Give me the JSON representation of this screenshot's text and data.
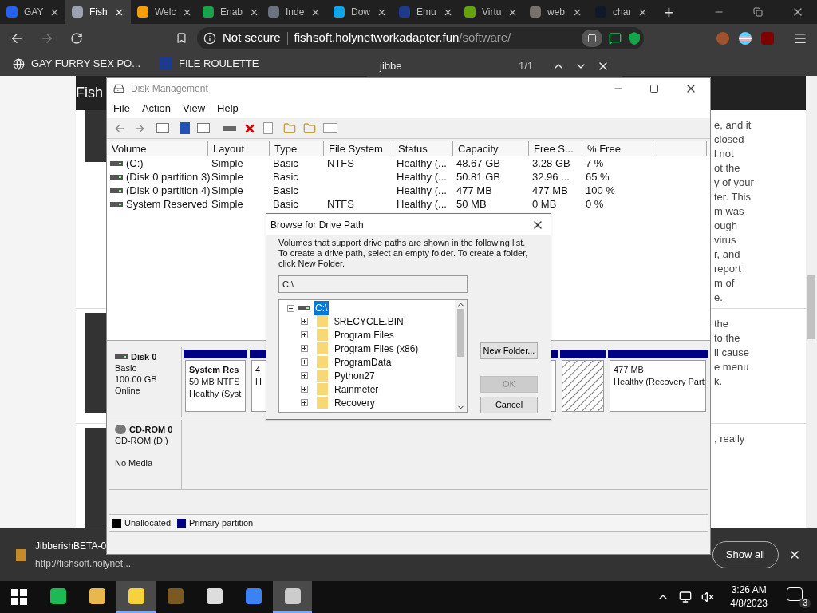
{
  "browser": {
    "tabs": [
      {
        "title": "GAY",
        "selected": false
      },
      {
        "title": "Fish",
        "selected": true
      },
      {
        "title": "Welc",
        "selected": false
      },
      {
        "title": "Enab",
        "selected": false
      },
      {
        "title": "Inde",
        "selected": false
      },
      {
        "title": "Dow",
        "selected": false
      },
      {
        "title": "Emu",
        "selected": false
      },
      {
        "title": "Virtu",
        "selected": false
      },
      {
        "title": "web",
        "selected": false
      },
      {
        "title": "char",
        "selected": false
      }
    ],
    "new_tab": "+",
    "security": "Not secure",
    "url_host": "fishsoft.holynetworkadapter.fun",
    "url_path": "/software/",
    "bookmarks": [
      "GAY FURRY SEX PO...",
      "FILE ROULETTE"
    ],
    "find": {
      "value": "jibbe",
      "count": "1/1"
    }
  },
  "page": {
    "header": "Fish",
    "cards": [
      {
        "lines": [
          "e, and it",
          "closed",
          "l not",
          "ot the",
          "y of your",
          "ter. This",
          "m was",
          "ough",
          "virus",
          "r, and",
          "report",
          "m of",
          "e."
        ]
      },
      {
        "lines": [
          "the",
          "to the",
          "ll cause",
          "e menu",
          "k."
        ]
      },
      {
        "lines": [
          ", really"
        ]
      }
    ]
  },
  "disk_management": {
    "title": "Disk Management",
    "menu": [
      "File",
      "Action",
      "View",
      "Help"
    ],
    "columns": [
      "Volume",
      "Layout",
      "Type",
      "File System",
      "Status",
      "Capacity",
      "Free S...",
      "% Free"
    ],
    "rows": [
      [
        "(C:)",
        "Simple",
        "Basic",
        "NTFS",
        "Healthy (...",
        "48.67 GB",
        "3.28 GB",
        "7 %"
      ],
      [
        "(Disk 0 partition 3)",
        "Simple",
        "Basic",
        "",
        "Healthy (...",
        "50.81 GB",
        "32.96 ...",
        "65 %"
      ],
      [
        "(Disk 0 partition 4)",
        "Simple",
        "Basic",
        "",
        "Healthy (...",
        "477 MB",
        "477 MB",
        "100 %"
      ],
      [
        "System Reserved",
        "Simple",
        "Basic",
        "NTFS",
        "Healthy (...",
        "50 MB",
        "0 MB",
        "0 %"
      ]
    ],
    "disks": [
      {
        "kind": "disk",
        "name": "Disk 0",
        "lines": [
          "Basic",
          "100.00 GB",
          "Online"
        ],
        "partitions": [
          {
            "kind": "primary",
            "selected": false,
            "title": "System Res",
            "lines": [
              "50 MB NTFS",
              "Healthy (Syst"
            ]
          },
          {
            "kind": "primary",
            "selected": false,
            "lines": [
              "4",
              "H"
            ]
          },
          {
            "kind": "primary",
            "selected": true
          },
          {
            "kind": "primary",
            "selected": false,
            "lines": [
              "477 MB",
              "Healthy (Recovery Parti"
            ]
          }
        ]
      },
      {
        "kind": "cdrom",
        "name": "CD-ROM 0",
        "lines": [
          "CD-ROM (D:)"
        ],
        "media": "No Media"
      }
    ],
    "legend": [
      {
        "label": "Unallocated",
        "color": "#000000"
      },
      {
        "label": "Primary partition",
        "color": "#000080"
      }
    ]
  },
  "dialog": {
    "title": "Browse for Drive Path",
    "description": "Volumes that support drive paths are shown in the following list. To create a drive path, select an empty folder. To create a folder, click New Folder.",
    "path": "C:\\",
    "tree": {
      "label": "C:\\",
      "selected": true,
      "expanded": true,
      "children": [
        {
          "label": "$RECYCLE.BIN",
          "selected": false,
          "expanded": false
        },
        {
          "label": "Program Files",
          "selected": false,
          "expanded": false
        },
        {
          "label": "Program Files (x86)",
          "selected": false,
          "expanded": false
        },
        {
          "label": "ProgramData",
          "selected": false,
          "expanded": false
        },
        {
          "label": "Python27",
          "selected": false,
          "expanded": false
        },
        {
          "label": "Rainmeter",
          "selected": false,
          "expanded": false
        },
        {
          "label": "Recovery",
          "selected": false,
          "expanded": false
        }
      ]
    },
    "buttons": [
      {
        "label": "New Folder...",
        "disabled": false
      },
      {
        "label": "OK",
        "disabled": true
      },
      {
        "label": "Cancel",
        "disabled": false
      }
    ]
  },
  "download": {
    "file": "JibberishBETA-0",
    "url": "http://fishsoft.holynet...",
    "show_all": "Show all"
  },
  "taskbar": {
    "apps": [
      {
        "active": false
      },
      {
        "active": false
      },
      {
        "active": true
      },
      {
        "active": false
      },
      {
        "active": false
      },
      {
        "active": false
      },
      {
        "active": true
      }
    ],
    "time": "3:26 AM",
    "date": "4/8/2023",
    "notifications": "3"
  }
}
